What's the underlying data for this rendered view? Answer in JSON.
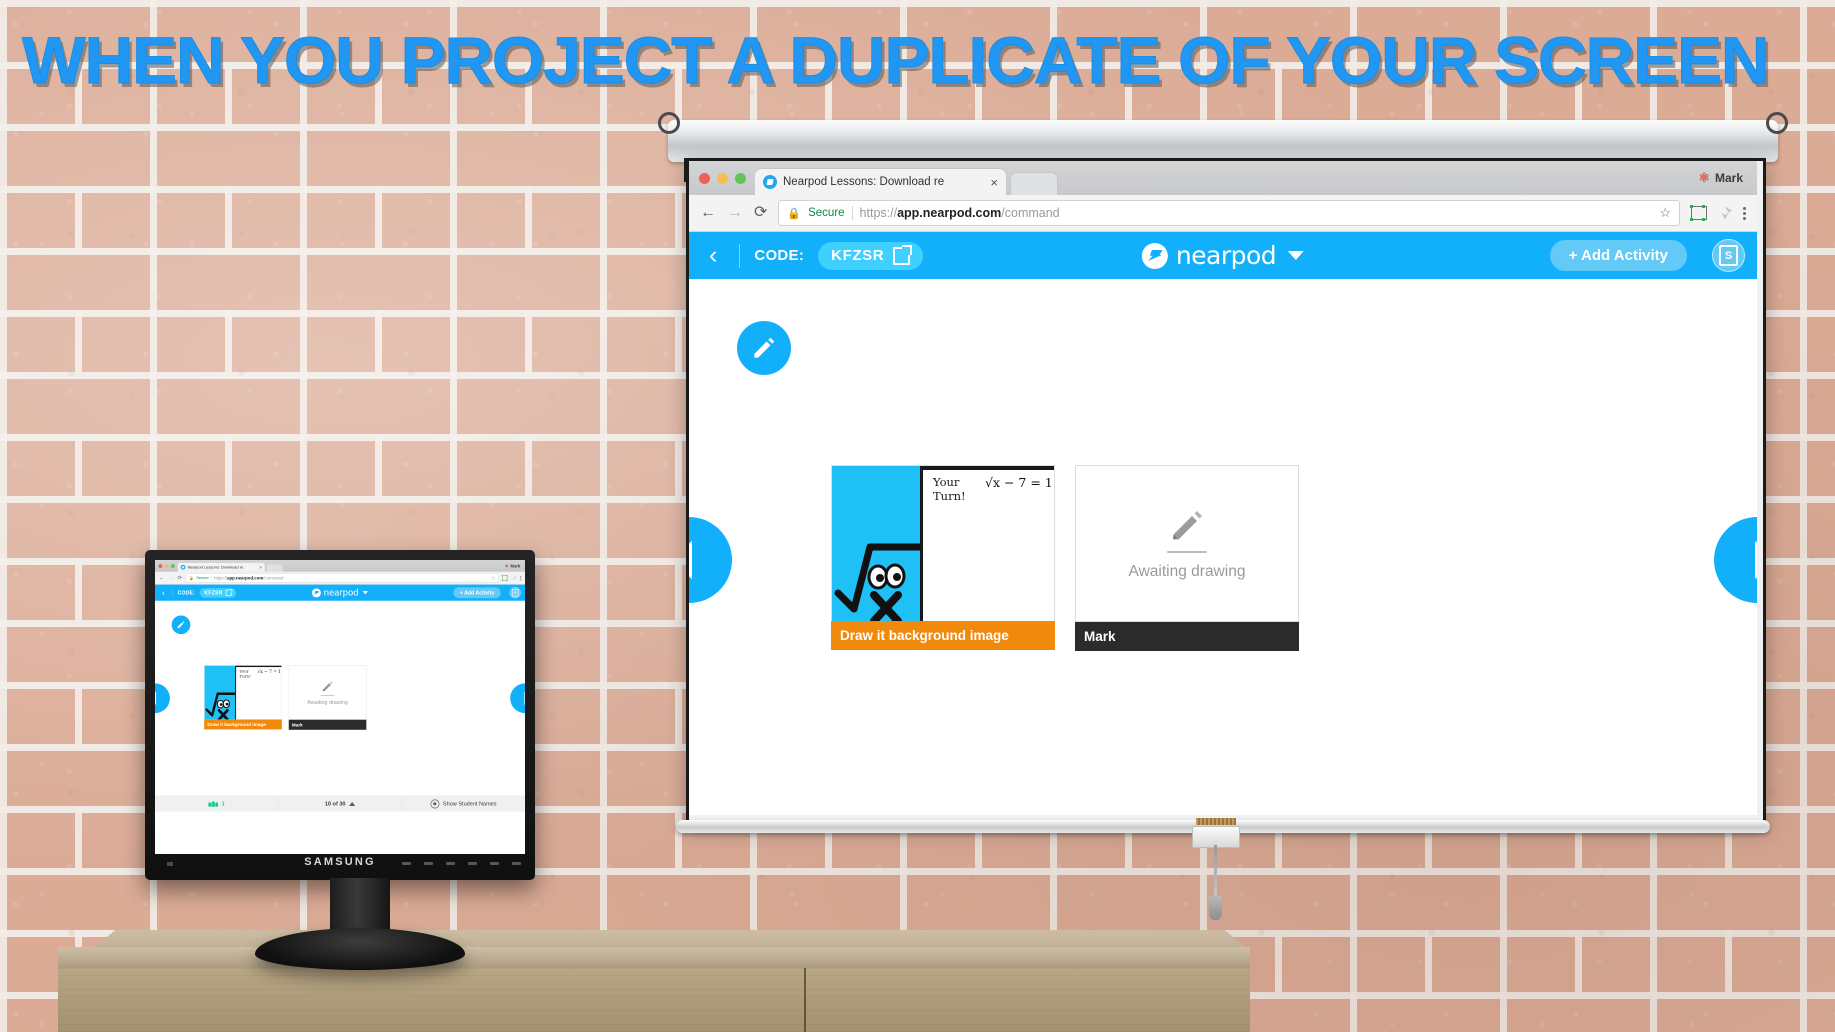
{
  "headline": "WHEN YOU PROJECT A DUPLICATE OF YOUR SCREEN",
  "colors": {
    "headline_blue": "#2196f3",
    "nearpod_blue": "#12b0fb",
    "code_pill": "#3fd0ff",
    "orange_caption": "#f1890c",
    "dark_caption": "#2b2b2b",
    "green_count": "#14ca8e",
    "brick": "#d8a893",
    "mortar": "#f2ece7",
    "wood": "#b8a684"
  },
  "browser": {
    "tab": {
      "title": "Nearpod Lessons: Download re",
      "close_label": "×",
      "favicon": "nearpod-favicon"
    },
    "profile_name": "Mark",
    "nav": {
      "back": "←",
      "forward": "→",
      "reload": "⟳"
    },
    "omnibox": {
      "lock": "🔒",
      "secure_label": "Secure",
      "url_scheme": "https://",
      "url_host": "app.nearpod.com",
      "url_path": "/command",
      "star": "☆",
      "menu": "kebab-menu"
    }
  },
  "nearpod": {
    "back_chevron": "‹",
    "code_label": "CODE:",
    "code_value": "KFZSR",
    "brand": "nearpod",
    "add_activity": "+ Add Activity",
    "s_button": "S",
    "activity_badge": "pencil-icon",
    "prev_arrow": "◀",
    "next_arrow": "▶",
    "cards": [
      {
        "caption": "Draw it background image",
        "caption_style": "orange",
        "handwriting": "Your\nTurn!",
        "equation": "√x − 7 = 1"
      },
      {
        "status": "Awaiting drawing",
        "caption": "Mark",
        "caption_style": "dark",
        "icon": "pencil-icon"
      }
    ],
    "bottom": {
      "participants_count": "1",
      "participants_icon": "people-icon",
      "page_indicator": "10 of 30",
      "expand_icon": "triangle-up-icon",
      "show_names_icon": "eye-icon",
      "show_names_label": "Show Student Names"
    }
  },
  "monitor": {
    "brand": "SAMSUNG"
  }
}
